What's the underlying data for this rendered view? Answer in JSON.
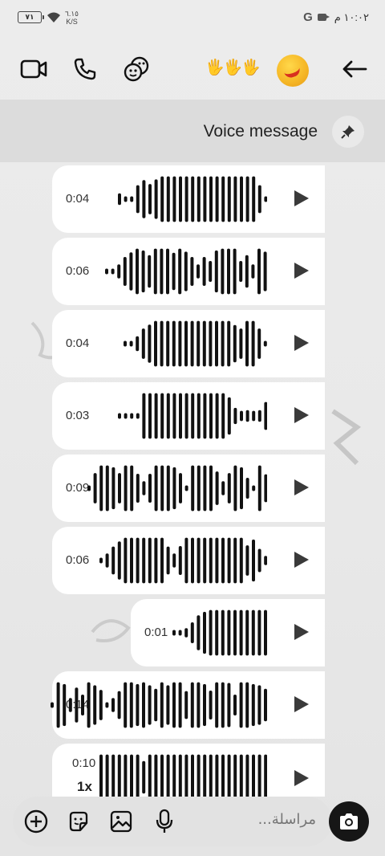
{
  "status_bar": {
    "battery_level": "٧١",
    "net_speed_value": "٦.١٥",
    "net_speed_unit": "K/S",
    "google_letter": "G",
    "time": "١٠:٠٢ م"
  },
  "header": {
    "reaction_emoji": "🖐🖐🖐",
    "icons": [
      "video-call-icon",
      "phone-icon",
      "stickers-icon",
      "back-arrow-icon"
    ]
  },
  "pinned": {
    "label": "Voice message"
  },
  "messages": [
    {
      "duration": "0:04",
      "bars": [
        0.25,
        0.12,
        0.12,
        0.6,
        0.82,
        0.65,
        0.85,
        0.98,
        0.98,
        0.98,
        0.98,
        0.98,
        0.98,
        0.98,
        0.98,
        0.98,
        0.98,
        0.98,
        0.98,
        0.98,
        0.98,
        0.98,
        0.98,
        0.6,
        0.12
      ]
    },
    {
      "duration": "0:06",
      "bars": [
        0.12,
        0.12,
        0.3,
        0.62,
        0.82,
        0.98,
        0.9,
        0.7,
        0.98,
        0.98,
        0.98,
        0.8,
        0.98,
        0.85,
        0.62,
        0.3,
        0.62,
        0.45,
        0.9,
        0.98,
        0.98,
        0.98,
        0.45,
        0.7,
        0.3,
        0.98,
        0.85
      ]
    },
    {
      "duration": "0:04",
      "bars": [
        0.12,
        0.12,
        0.32,
        0.65,
        0.82,
        0.98,
        0.98,
        0.98,
        0.98,
        0.98,
        0.98,
        0.98,
        0.98,
        0.98,
        0.98,
        0.98,
        0.98,
        0.98,
        0.8,
        0.65,
        0.98,
        0.98,
        0.65,
        0.12
      ]
    },
    {
      "duration": "0:03",
      "bars": [
        0.12,
        0.12,
        0.12,
        0.12,
        0.98,
        0.98,
        0.98,
        0.98,
        0.98,
        0.98,
        0.98,
        0.98,
        0.98,
        0.98,
        0.98,
        0.98,
        0.98,
        0.98,
        0.8,
        0.35,
        0.22,
        0.25,
        0.22,
        0.25,
        0.6
      ]
    },
    {
      "duration": "0:09",
      "bars": [
        0.12,
        0.65,
        0.98,
        0.98,
        0.9,
        0.65,
        0.98,
        0.98,
        0.62,
        0.3,
        0.62,
        0.98,
        0.98,
        0.98,
        0.9,
        0.65,
        0.12,
        0.98,
        0.98,
        0.98,
        0.98,
        0.72,
        0.3,
        0.65,
        0.98,
        0.9,
        0.45,
        0.12,
        0.98,
        0.6
      ]
    },
    {
      "duration": "0:06",
      "bars": [
        0.12,
        0.3,
        0.6,
        0.82,
        0.98,
        0.98,
        0.98,
        0.98,
        0.98,
        0.98,
        0.98,
        0.6,
        0.3,
        0.62,
        0.98,
        0.98,
        0.98,
        0.98,
        0.98,
        0.98,
        0.98,
        0.98,
        0.98,
        0.98,
        0.65,
        0.9,
        0.5,
        0.2
      ]
    },
    {
      "duration": "0:01",
      "bars": [
        0.12,
        0.12,
        0.2,
        0.45,
        0.75,
        0.9,
        0.98,
        0.98,
        0.98,
        0.98,
        0.98,
        0.98,
        0.98,
        0.98,
        0.98,
        0.98
      ]
    },
    {
      "duration": "0:14",
      "bars": [
        0.12,
        0.98,
        0.9,
        0.3,
        0.75,
        0.45,
        0.98,
        0.85,
        0.65,
        0.12,
        0.3,
        0.6,
        0.98,
        0.98,
        0.9,
        0.98,
        0.85,
        0.7,
        0.98,
        0.85,
        0.98,
        0.98,
        0.6,
        0.98,
        0.98,
        0.9,
        0.62,
        0.98,
        0.98,
        0.95,
        0.45,
        0.98,
        0.98,
        0.9,
        0.85,
        0.7
      ]
    }
  ],
  "last_message": {
    "duration": "0:10",
    "speed": "1x",
    "bars": [
      0.98,
      0.98,
      0.98,
      0.98,
      0.98,
      0.98,
      0.98,
      0.7,
      0.98,
      0.98,
      0.98,
      0.98,
      0.98,
      0.98,
      0.98,
      0.98,
      0.98,
      0.98,
      0.98,
      0.98,
      0.98,
      0.98,
      0.98,
      0.98,
      0.98,
      0.98,
      0.98,
      0.98
    ]
  },
  "composer": {
    "placeholder": "مراسلة...",
    "icons": [
      "add-icon",
      "sticker-icon",
      "gallery-icon",
      "microphone-icon",
      "camera-icon"
    ]
  },
  "colors": {
    "background": "#e8e8e8",
    "bubble": "#ffffff",
    "waveform": "#111111",
    "camera_button": "#161616"
  }
}
